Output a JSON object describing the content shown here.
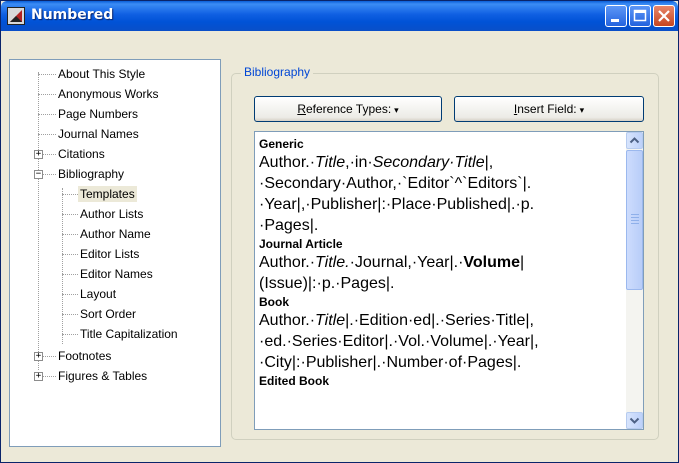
{
  "window": {
    "title": "Numbered"
  },
  "tree": {
    "items": [
      {
        "label": "About This Style"
      },
      {
        "label": "Anonymous Works"
      },
      {
        "label": "Page Numbers"
      },
      {
        "label": "Journal Names"
      },
      {
        "label": "Citations",
        "expander": "+"
      },
      {
        "label": "Bibliography",
        "expander": "−"
      },
      {
        "label": "Templates",
        "selected": true
      },
      {
        "label": "Author Lists"
      },
      {
        "label": "Author Name"
      },
      {
        "label": "Editor Lists"
      },
      {
        "label": "Editor Names"
      },
      {
        "label": "Layout"
      },
      {
        "label": "Sort Order"
      },
      {
        "label": "Title Capitalization"
      },
      {
        "label": "Footnotes",
        "expander": "+"
      },
      {
        "label": "Figures & Tables",
        "expander": "+"
      }
    ]
  },
  "bibliography": {
    "group_label": "Bibliography",
    "reference_types_label": "Reference Types:",
    "reference_types_key": "R",
    "reference_types_rest": "eference Types:",
    "insert_field_key": "I",
    "insert_field_rest": "nsert Field:",
    "dropdown_arrow": "▾"
  },
  "templates": {
    "generic": {
      "heading": "Generic",
      "line1_a": "Author.·",
      "line1_b": "Title",
      "line1_c": ",·in·",
      "line1_d": "Secondary·Title",
      "line1_e": "|,",
      "line2": "·Secondary·Author,·`Editor`^`Editors`|.",
      "line3": "·Year|,·Publisher|:·Place·Published|.·p.",
      "line4": "·Pages|."
    },
    "journal_article": {
      "heading": "Journal Article",
      "line1_a": "Author.·",
      "line1_b": "Title.",
      "line1_c": "·Journal,·Year|.·",
      "line1_d": "Volume",
      "line1_e": "|",
      "line2": "(Issue)|:·p.·Pages|."
    },
    "book": {
      "heading": "Book",
      "line1_a": "Author.·",
      "line1_b": "Title",
      "line1_c": "|.·Edition·ed|.·Series·Title|,",
      "line2": "·ed.·Series·Editor|.·Vol.·Volume|.·Year|,",
      "line3": "·City|:·Publisher|.·Number·of·Pages|."
    },
    "edited_book": {
      "heading": "Edited Book"
    }
  },
  "icons": {
    "app": "endnote-app-icon",
    "minimize": "minimize-icon",
    "maximize": "maximize-icon",
    "close": "close-icon",
    "scroll_up": "chevron-up-icon",
    "scroll_down": "chevron-down-icon"
  },
  "colors": {
    "titlebar": "#0054e3",
    "group_label": "#0046d5",
    "selection": "#ece9d8"
  }
}
